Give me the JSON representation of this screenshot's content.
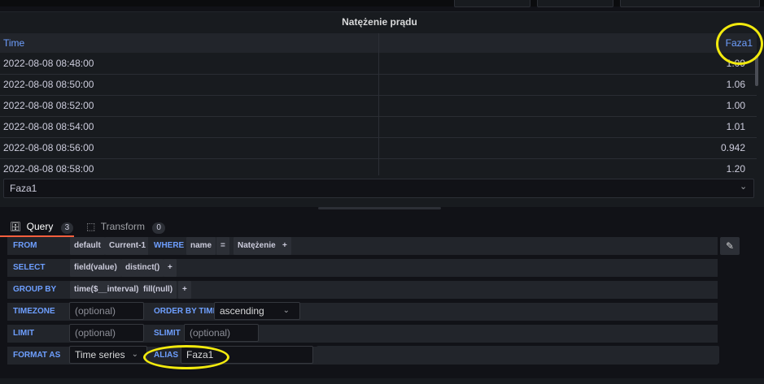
{
  "panel": {
    "title": "Natężenie prądu",
    "columns": [
      "Time",
      "Faza1"
    ],
    "rows": [
      {
        "time": "2022-08-08 08:48:00",
        "value": "1.09"
      },
      {
        "time": "2022-08-08 08:50:00",
        "value": "1.06"
      },
      {
        "time": "2022-08-08 08:52:00",
        "value": "1.00"
      },
      {
        "time": "2022-08-08 08:54:00",
        "value": "1.01"
      },
      {
        "time": "2022-08-08 08:56:00",
        "value": "0.942"
      },
      {
        "time": "2022-08-08 08:58:00",
        "value": "1.20"
      }
    ],
    "series_select": "Faza1"
  },
  "tabs": {
    "query": {
      "label": "Query",
      "count": "3"
    },
    "transform": {
      "label": "Transform",
      "count": "0"
    }
  },
  "query": {
    "from": {
      "kw": "FROM",
      "policy": "default",
      "measurement": "Current-1",
      "where_kw": "WHERE",
      "tag": "name",
      "op": "=",
      "tag_value": "Natężenie",
      "add": "+"
    },
    "select": {
      "kw": "SELECT",
      "field": "field(value)",
      "agg": "distinct()",
      "add": "+"
    },
    "group_by": {
      "kw": "GROUP BY",
      "time": "time($__interval)",
      "fill": "fill(null)",
      "add": "+"
    },
    "timezone": {
      "kw": "TIMEZONE",
      "placeholder": "(optional)",
      "order_kw": "ORDER BY TIME",
      "order_value": "ascending"
    },
    "limit": {
      "kw": "LIMIT",
      "placeholder": "(optional)",
      "slimit_kw": "SLIMIT",
      "slimit_placeholder": "(optional)"
    },
    "format": {
      "kw": "FORMAT AS",
      "format_value": "Time series",
      "alias_kw": "ALIAS",
      "alias_value": "Faza1"
    }
  },
  "icons": {
    "database": "database-icon",
    "transform": "transform-icon",
    "pencil": "pencil-icon",
    "chevron": "chevron-down-icon"
  },
  "colors": {
    "accent": "#6e9fff",
    "highlight_circle": "#f2ea0e",
    "active_tab": "#f55f3e"
  }
}
